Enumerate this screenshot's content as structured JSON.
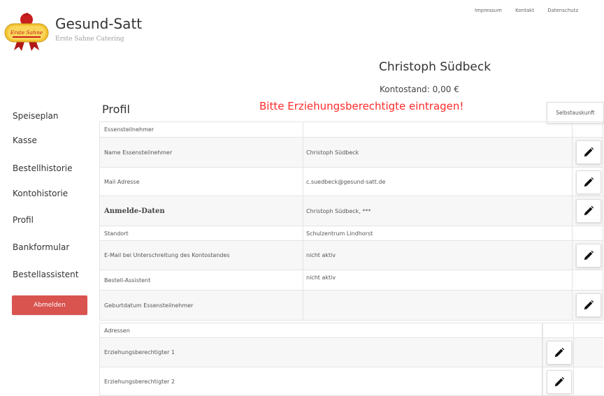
{
  "header": {
    "brand": "Gesund-Satt",
    "tagline": "Erste Sahne Catering",
    "logo_text": "Erste Sahne",
    "links": [
      "Impressum",
      "Kontakt",
      "Datenschutz"
    ]
  },
  "user": {
    "name": "Christoph Südbeck",
    "balance": "Kontostand: 0,00 €"
  },
  "alert": "Bitte Erziehungsberechtigte eintragen!",
  "sidebar": {
    "items": [
      {
        "label": "Speiseplan"
      },
      {
        "label": "Kasse"
      },
      {
        "label": "Bestellhistorie"
      },
      {
        "label": "Kontohistorie"
      },
      {
        "label": "Profil"
      },
      {
        "label": "Bankformular"
      },
      {
        "label": "Bestellassistent"
      }
    ],
    "logout": "Abmelden"
  },
  "page_title": "Profil",
  "self_info_button": "Selbstauskunft",
  "profile_table": {
    "header": "Essensteilnehmer",
    "rows": [
      {
        "label": "Name Essensteilnehmer",
        "value": "Christoph Südbeck"
      },
      {
        "label": "Mail Adresse",
        "value": "c.suedbeck@gesund-satt.de"
      },
      {
        "label": "Anmelde-Daten",
        "value": "Christoph Südbeck, ***"
      },
      {
        "label": "Standort",
        "value": "Schulzentrum Lindhorst"
      },
      {
        "label": "E-Mail bei Unterschreitung des Kontostandes",
        "value": "nicht aktiv"
      },
      {
        "label": "Bestell-Assistent",
        "value": "nicht aktiv"
      },
      {
        "label": "Geburtdatum Essensteilnehmer",
        "value": ""
      }
    ]
  },
  "address_table": {
    "header": "Adressen",
    "rows": [
      {
        "label": "Erziehungsberechtigter 1"
      },
      {
        "label": "Erziehungsberechtigter 2"
      }
    ]
  },
  "colors": {
    "alert": "#ff2a2a",
    "logout_button": "#d9534f",
    "row_alt": "#f7f7f7"
  },
  "icons": {
    "edit": "pencil-icon"
  }
}
